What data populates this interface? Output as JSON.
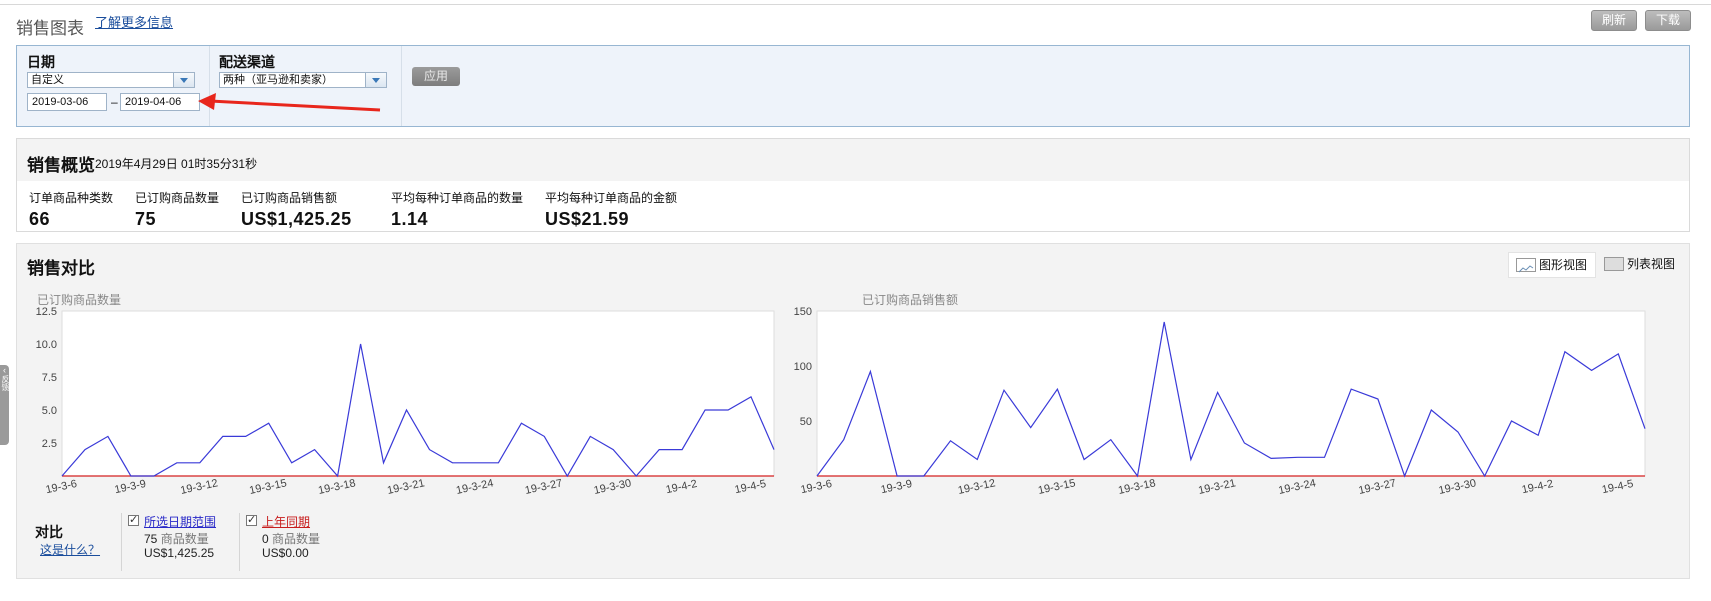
{
  "header": {
    "title": "销售图表",
    "learn_more": "了解更多信息",
    "refresh": "刷新",
    "download": "下载"
  },
  "filters": {
    "date_label": "日期",
    "date_range_select": "自定义",
    "start_date": "2019-03-06",
    "date_separator": "–",
    "end_date": "2019-04-06",
    "channel_label": "配送渠道",
    "channel_select": "两种（亚马逊和卖家）",
    "apply": "应用"
  },
  "overview": {
    "title": "销售概览",
    "timestamp": "2019年4月29日 01时35分31秒",
    "metrics": [
      {
        "label": "订单商品种类数",
        "value": "66"
      },
      {
        "label": "已订购商品数量",
        "value": "75"
      },
      {
        "label": "已订购商品销售额",
        "value": "US$1,425.25"
      },
      {
        "label": "平均每种订单商品的数量",
        "value": "1.14"
      },
      {
        "label": "平均每种订单商品的金额",
        "value": "US$21.59"
      }
    ]
  },
  "comparison": {
    "title": "销售对比",
    "graph_view": "图形视图",
    "list_view": "列表视图",
    "compare_label": "对比",
    "whats_this": "这是什么？",
    "legend": [
      {
        "name": "所选日期范围",
        "color": "#2a2ac8",
        "count": "75",
        "count_label": "商品数量",
        "amount": "US$1,425.25"
      },
      {
        "name": "上年同期",
        "color": "#c81e1e",
        "count": "0",
        "count_label": "商品数量",
        "amount": "US$0.00"
      }
    ],
    "side_tab": "反馈"
  },
  "chart_data": [
    {
      "type": "line",
      "title": "已订购商品数量",
      "x": [
        "19-3-6",
        "19-3-7",
        "19-3-8",
        "19-3-9",
        "19-3-10",
        "19-3-11",
        "19-3-12",
        "19-3-13",
        "19-3-14",
        "19-3-15",
        "19-3-16",
        "19-3-17",
        "19-3-18",
        "19-3-19",
        "19-3-20",
        "19-3-21",
        "19-3-22",
        "19-3-23",
        "19-3-24",
        "19-3-25",
        "19-3-26",
        "19-3-27",
        "19-3-28",
        "19-3-29",
        "19-3-30",
        "19-3-31",
        "19-4-1",
        "19-4-2",
        "19-4-3",
        "19-4-4",
        "19-4-5",
        "19-4-6"
      ],
      "xtick_labels": [
        "19-3-6",
        "19-3-9",
        "19-3-12",
        "19-3-15",
        "19-3-18",
        "19-3-21",
        "19-3-24",
        "19-3-27",
        "19-3-30",
        "19-4-2",
        "19-4-5"
      ],
      "yticks": [
        "2.5",
        "5.0",
        "7.5",
        "10.0",
        "12.5"
      ],
      "ylim": [
        0,
        12.5
      ],
      "series": [
        {
          "name": "所选日期范围",
          "color": "#3a3ad8",
          "values": [
            0,
            2,
            3,
            0,
            0,
            1,
            1,
            3,
            3,
            4,
            1,
            2,
            0,
            10,
            1,
            5,
            2,
            1,
            1,
            1,
            4,
            3,
            0,
            3,
            2,
            0,
            2,
            2,
            5,
            5,
            6,
            2
          ]
        },
        {
          "name": "上年同期",
          "color": "#d42020",
          "values": [
            0,
            0,
            0,
            0,
            0,
            0,
            0,
            0,
            0,
            0,
            0,
            0,
            0,
            0,
            0,
            0,
            0,
            0,
            0,
            0,
            0,
            0,
            0,
            0,
            0,
            0,
            0,
            0,
            0,
            0,
            0,
            0
          ]
        }
      ]
    },
    {
      "type": "line",
      "title": "已订购商品销售额",
      "x": [
        "19-3-6",
        "19-3-7",
        "19-3-8",
        "19-3-9",
        "19-3-10",
        "19-3-11",
        "19-3-12",
        "19-3-13",
        "19-3-14",
        "19-3-15",
        "19-3-16",
        "19-3-17",
        "19-3-18",
        "19-3-19",
        "19-3-20",
        "19-3-21",
        "19-3-22",
        "19-3-23",
        "19-3-24",
        "19-3-25",
        "19-3-26",
        "19-3-27",
        "19-3-28",
        "19-3-29",
        "19-3-30",
        "19-3-31",
        "19-4-1",
        "19-4-2",
        "19-4-3",
        "19-4-4",
        "19-4-5",
        "19-4-6"
      ],
      "xtick_labels": [
        "19-3-6",
        "19-3-9",
        "19-3-12",
        "19-3-15",
        "19-3-18",
        "19-3-21",
        "19-3-24",
        "19-3-27",
        "19-3-30",
        "19-4-2",
        "19-4-5"
      ],
      "yticks": [
        "50",
        "100",
        "150"
      ],
      "ylim": [
        0,
        150
      ],
      "series": [
        {
          "name": "所选日期范围",
          "color": "#3a3ad8",
          "values": [
            0,
            33,
            95,
            0,
            0,
            32,
            15,
            78,
            44,
            79,
            15,
            33,
            0,
            140,
            15,
            76,
            30,
            16,
            17,
            17,
            79,
            70,
            0,
            60,
            40,
            0,
            50,
            37,
            113,
            96,
            111,
            43
          ]
        },
        {
          "name": "上年同期",
          "color": "#d42020",
          "values": [
            0,
            0,
            0,
            0,
            0,
            0,
            0,
            0,
            0,
            0,
            0,
            0,
            0,
            0,
            0,
            0,
            0,
            0,
            0,
            0,
            0,
            0,
            0,
            0,
            0,
            0,
            0,
            0,
            0,
            0,
            0,
            0
          ]
        }
      ]
    }
  ]
}
